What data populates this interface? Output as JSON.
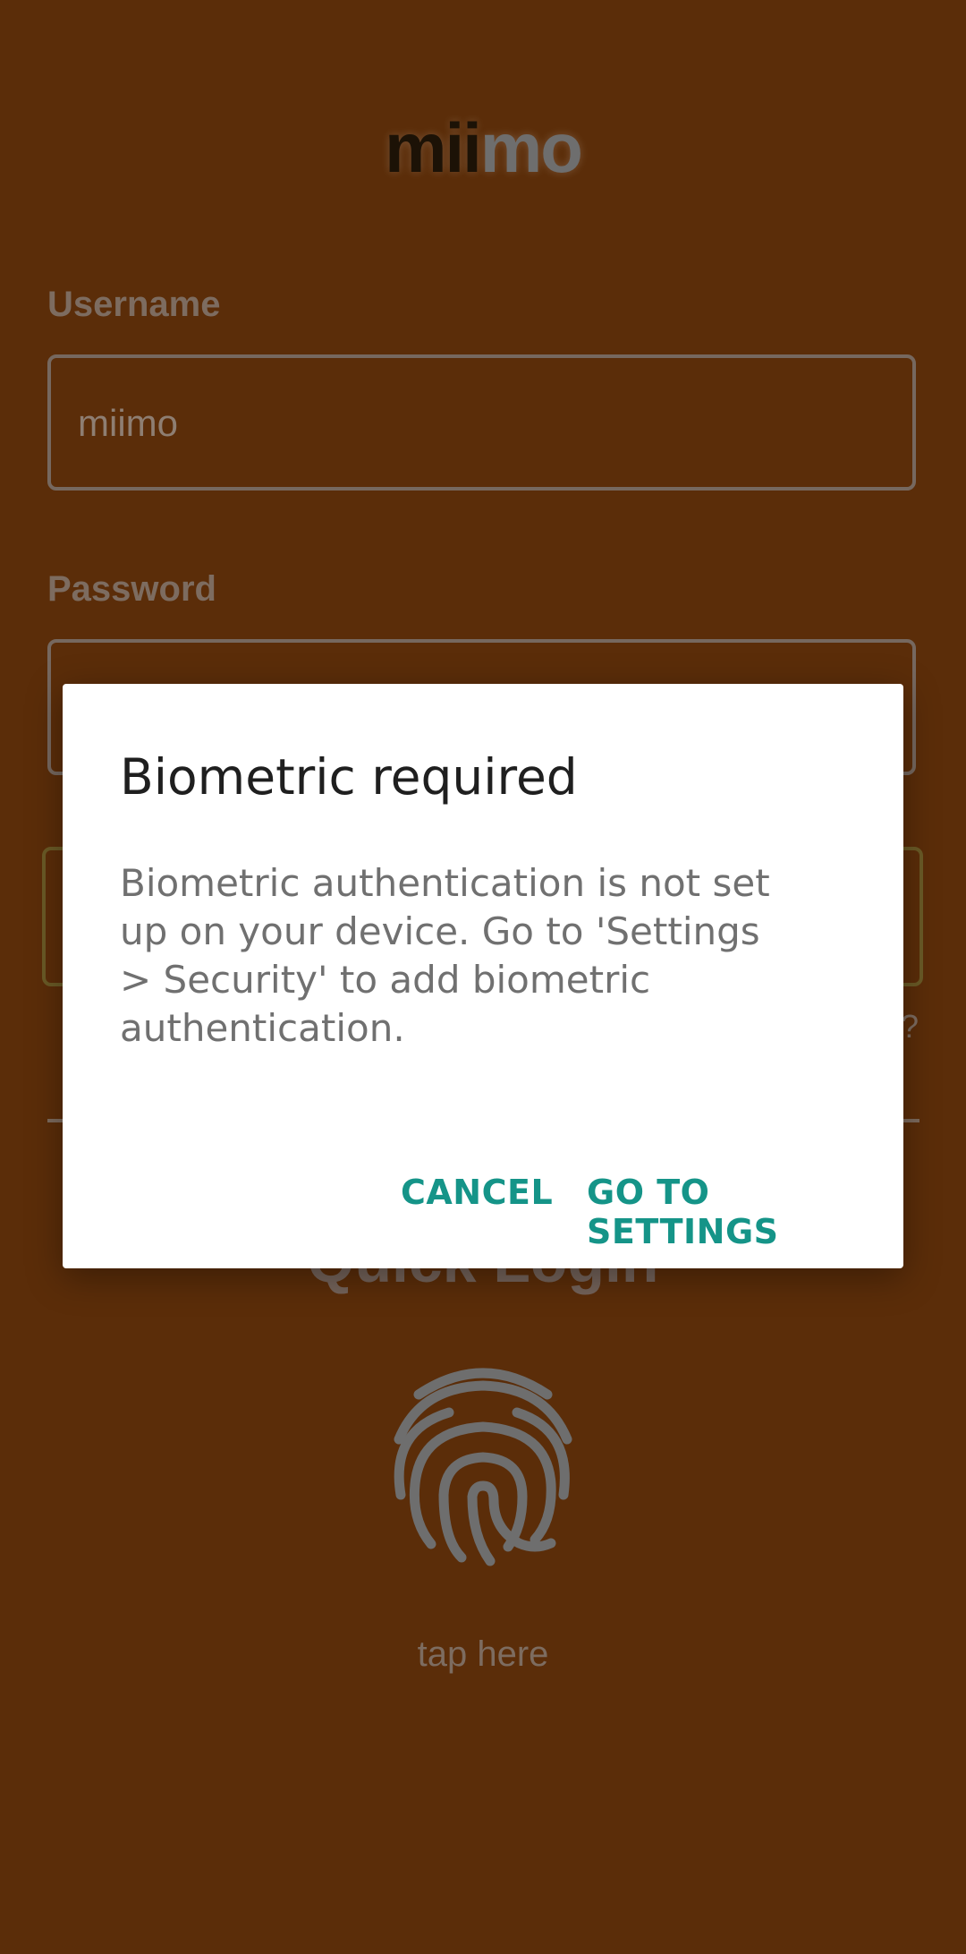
{
  "app": {
    "logo_dark": "mii",
    "logo_light": "mo"
  },
  "login_form": {
    "username_label": "Username",
    "username_value": "miimo",
    "password_label": "Password",
    "password_value": "",
    "forgot_text": "?"
  },
  "quick_login": {
    "title": "Quick Login",
    "tap_text": "tap here"
  },
  "dialog": {
    "title": "Biometric required",
    "message": "Biometric authentication is not set up on your device. Go to 'Settings > Security' to add biometric authentication.",
    "cancel_label": "CANCEL",
    "settings_label": "GO TO SETTINGS"
  },
  "colors": {
    "overlay_background": "#5b2d09",
    "accent": "#159488",
    "dialog_background": "#ffffff"
  },
  "icons": {
    "fingerprint": "fingerprint-icon"
  }
}
